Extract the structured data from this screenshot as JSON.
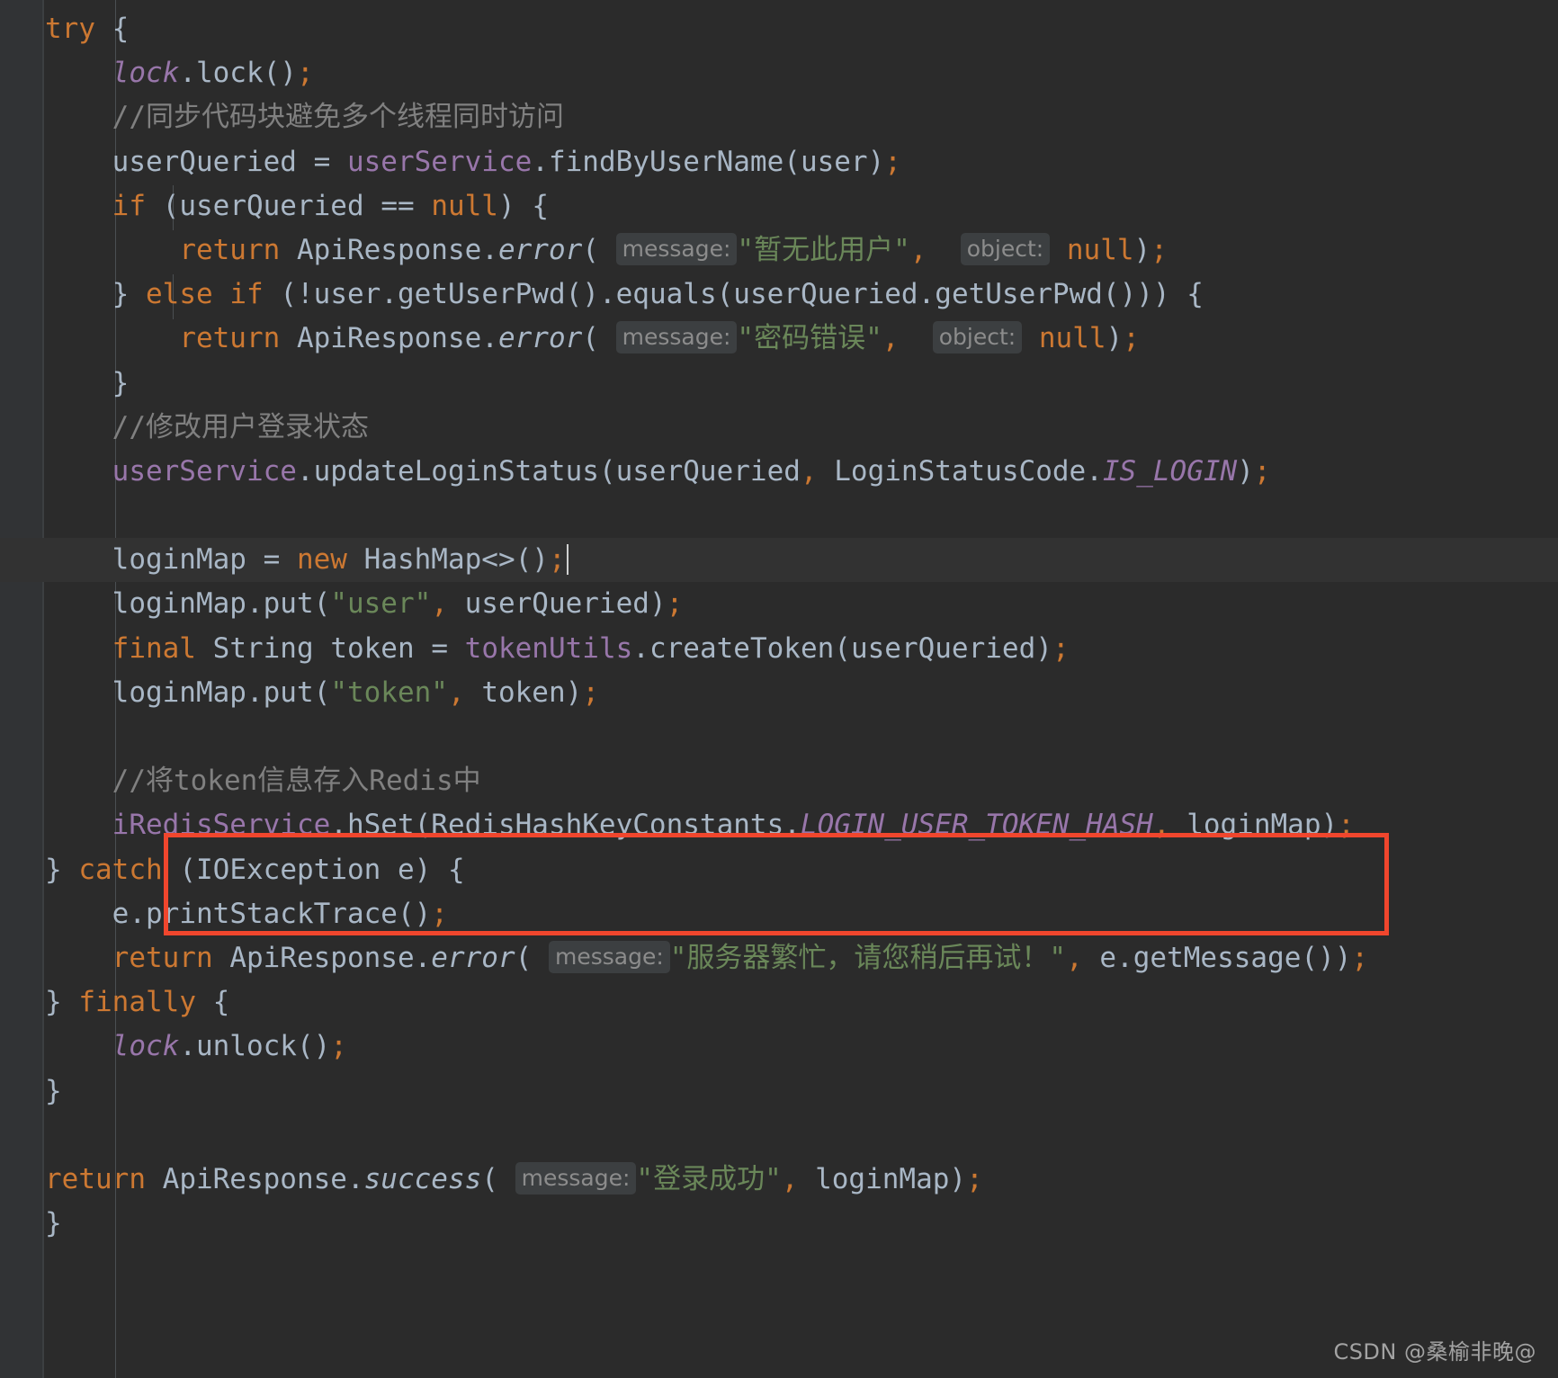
{
  "editor": {
    "theme": "darcula",
    "background": "#2b2b2b",
    "gutter_background": "#313335",
    "caret_line_background": "#323232",
    "default_text_color": "#a9b7c6",
    "keyword_color": "#cc7832",
    "string_color": "#6a8759",
    "comment_color": "#808080",
    "field_color": "#9876aa",
    "hint_background": "#3c3f41",
    "hint_text_color": "#8c8c8c",
    "annotation_box_color": "#f0462d"
  },
  "code_lines": [
    {
      "id": "line-try",
      "text": "try {"
    },
    {
      "id": "line-lock",
      "text": "lock.lock();"
    },
    {
      "id": "line-comment-sync",
      "text": "//同步代码块避免多个线程同时访问"
    },
    {
      "id": "line-find-user",
      "text": "userQueried = userService.findByUserName(user);"
    },
    {
      "id": "line-if-null",
      "text": "if (userQueried == null) {"
    },
    {
      "id": "line-return-no-user",
      "text": "return ApiResponse.error( message: \"暂无此用户\",  object: null);"
    },
    {
      "id": "line-else-if-pwd",
      "text": "} else if (!user.getUserPwd().equals(userQueried.getUserPwd())) {"
    },
    {
      "id": "line-return-bad-pwd",
      "text": "return ApiResponse.error( message: \"密码错误\",  object: null);"
    },
    {
      "id": "line-close-if",
      "text": "}"
    },
    {
      "id": "line-comment-status",
      "text": "//修改用户登录状态"
    },
    {
      "id": "line-update-status",
      "text": "userService.updateLoginStatus(userQueried, LoginStatusCode.IS_LOGIN);"
    },
    {
      "id": "line-blank-1",
      "text": ""
    },
    {
      "id": "line-new-hashmap",
      "text": "loginMap = new HashMap<>();"
    },
    {
      "id": "line-put-user",
      "text": "loginMap.put(\"user\", userQueried);"
    },
    {
      "id": "line-create-token",
      "text": "final String token = tokenUtils.createToken(userQueried);"
    },
    {
      "id": "line-put-token",
      "text": "loginMap.put(\"token\", token);"
    },
    {
      "id": "line-blank-2",
      "text": ""
    },
    {
      "id": "line-comment-redis",
      "text": "//将token信息存入Redis中"
    },
    {
      "id": "line-hset",
      "text": "iRedisService.hSet(RedisHashKeyConstants.LOGIN_USER_TOKEN_HASH, loginMap);"
    },
    {
      "id": "line-catch",
      "text": "} catch (IOException e) {"
    },
    {
      "id": "line-printstacktrace",
      "text": "e.printStackTrace();"
    },
    {
      "id": "line-return-busy",
      "text": "return ApiResponse.error( message: \"服务器繁忙，请您稍后再试！\", e.getMessage());"
    },
    {
      "id": "line-finally",
      "text": "} finally {"
    },
    {
      "id": "line-unlock",
      "text": "lock.unlock();"
    },
    {
      "id": "line-close-finally",
      "text": "}"
    },
    {
      "id": "line-blank-3",
      "text": ""
    },
    {
      "id": "line-return-success",
      "text": "return ApiResponse.success( message: \"登录成功\", loginMap);"
    },
    {
      "id": "line-close-method",
      "text": "}"
    }
  ],
  "tokens": {
    "kw_try": "try",
    "kw_catch": "catch",
    "kw_finally": "finally",
    "kw_if": "if",
    "kw_else": "else",
    "kw_new": "new",
    "kw_return": "return",
    "kw_final": "final",
    "kw_null": "null",
    "brace_open": "{",
    "brace_close": "}",
    "semi": ";",
    "comma": ",",
    "paren_open": "(",
    "paren_close": ")",
    "field_lock": "lock",
    "id_userQueried": "userQueried",
    "id_userService": "userService",
    "id_user": "user",
    "id_tokenUtils": "tokenUtils",
    "id_iRedisService": "iRedisService",
    "id_loginMap": "loginMap",
    "id_token": "token",
    "id_e": "e",
    "cls_ApiResponse": "ApiResponse",
    "cls_String": "String",
    "cls_HashMap": "HashMap<>",
    "cls_IOException": "IOException",
    "cls_LoginStatusCode": "LoginStatusCode",
    "cls_RedisHashKeyConstants": "RedisHashKeyConstants",
    "const_IS_LOGIN": "IS_LOGIN",
    "const_LOGIN_USER_TOKEN_HASH": "LOGIN_USER_TOKEN_HASH",
    "m_lock": "lock",
    "m_unlock": "unlock",
    "m_error": "error",
    "m_success": "success",
    "m_findByUserName": "findByUserName",
    "m_getUserPwd": "getUserPwd",
    "m_equals": "equals",
    "m_updateLoginStatus": "updateLoginStatus",
    "m_put": "put",
    "m_createToken": "createToken",
    "m_hSet": "hSet",
    "m_printStackTrace": "printStackTrace",
    "m_getMessage": "getMessage",
    "op_assign": "=",
    "op_eq": "==",
    "op_not": "!",
    "dot": "."
  },
  "hints": {
    "message": "message:",
    "object": "object:"
  },
  "strings": {
    "no_such_user": "\"暂无此用户\"",
    "wrong_password": "\"密码错误\"",
    "server_busy": "\"服务器繁忙，请您稍后再试！\"",
    "login_success": "\"登录成功\"",
    "key_user": "\"user\"",
    "key_token": "\"token\""
  },
  "comments": {
    "sync_block": "//同步代码块避免多个线程同时访问",
    "update_login_status": "//修改用户登录状态",
    "store_token_redis": "//将token信息存入Redis中"
  },
  "annotation": {
    "box_label": "store-token-in-redis-highlight"
  },
  "watermark": {
    "text": "CSDN @桑榆非晚@"
  }
}
